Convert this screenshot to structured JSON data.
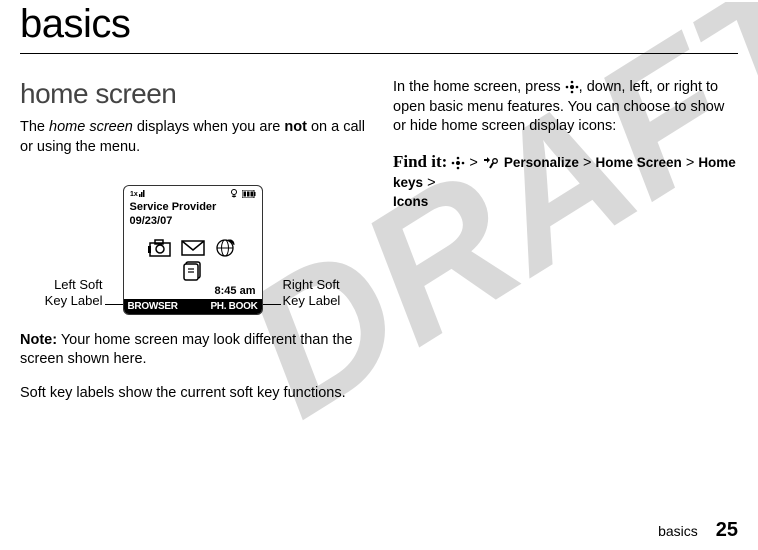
{
  "draft_text": "DRAFT",
  "page_title": "basics",
  "section_heading": "home screen",
  "intro_p1_a": "The ",
  "intro_p1_b": "home screen",
  "intro_p1_c": " displays when you are ",
  "intro_p1_d": "not",
  "intro_p1_e": " on a call or using the menu.",
  "left_label_l1": "Left Soft",
  "left_label_l2": "Key Label",
  "right_label_l1": "Right Soft",
  "right_label_l2": "Key Label",
  "phone": {
    "provider": "Service Provider",
    "date": "09/23/07",
    "time": "8:45 am",
    "soft_left": "BROWSER",
    "soft_right": "PH. BOOK"
  },
  "note_label": "Note:",
  "note_text": " Your home screen may look different than the screen shown here.",
  "soft_desc": "Soft key labels show the current soft key functions.",
  "right_p1": "In the home screen, press ",
  "right_p1b": ", down, left, or right to open basic menu features. You can choose to show or hide home screen display icons:",
  "find_it": "Find it:",
  "path_personalize": "Personalize",
  "path_home_screen": "Home Screen",
  "path_home_keys": "Home keys",
  "path_icons": "Icons",
  "gt": ">",
  "footer_text": "basics",
  "footer_num": "25"
}
